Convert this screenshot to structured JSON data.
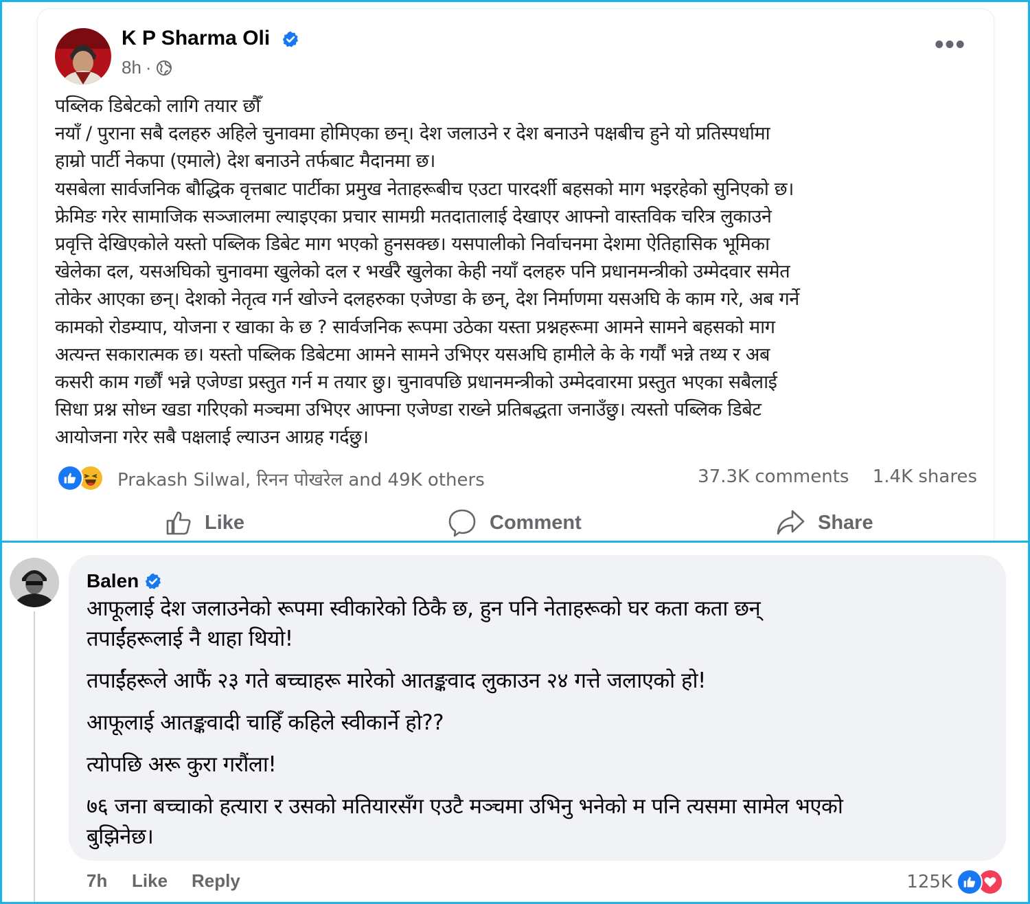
{
  "post": {
    "author": "K P Sharma Oli",
    "time": "8h",
    "separator": "·",
    "more_label": "•••",
    "body": [
      "पब्लिक डिबेटको लागि तयार छौँ",
      "नयाँ / पुराना सबै दलहरु अहिले चुनावमा होमिएका छन्। देश जलाउने र देश बनाउने पक्षबीच हुने यो प्रतिस्पर्धामा",
      "हाम्रो पार्टी नेकपा (एमाले) देश बनाउने तर्फबाट मैदानमा छ।",
      "यसबेला सार्वजनिक बौद्धिक वृत्तबाट पार्टीका प्रमुख नेताहरूबीच एउटा पारदर्शी बहसको माग भइरहेको सुनिएको छ।",
      "फ्रेमिङ गरेर सामाजिक सञ्जालमा ल्याइएका प्रचार सामग्री मतदातालाई देखाएर आफ्नो वास्तविक चरित्र लुकाउने",
      "प्रवृत्ति देखिएकोले यस्तो पब्लिक डिबेट माग भएको हुनसक्छ। यसपालीको निर्वाचनमा देशमा ऐतिहासिक भूमिका",
      "खेलेका दल, यसअघिको चुनावमा खुलेको दल र भर्खरै खुलेका केही नयाँ दलहरु पनि प्रधानमन्त्रीको उम्मेदवार समेत",
      "तोकेर आएका छन्। देशको नेतृत्व गर्न खोज्ने दलहरुका एजेण्डा के छन्, देश निर्माणमा यसअघि के काम गरे, अब गर्ने",
      "कामको रोडम्याप, योजना र  खाका के छ ? सार्वजनिक रूपमा उठेका यस्ता प्रश्नहरूमा आमने सामने बहसको माग",
      "अत्यन्त सकारात्मक छ। यस्तो पब्लिक डिबेटमा आमने सामने उभिएर यसअघि हामीले के के गर्यौं भन्ने तथ्य र अब",
      "कसरी काम गर्छौं भन्ने एजेण्डा प्रस्तुत गर्न म तयार छु। चुनावपछि प्रधानमन्त्रीको उम्मेदवारमा प्रस्तुत भएका सबैलाई",
      "सिधा प्रश्न सोध्न खडा गरिएको मञ्चमा उभिएर आफ्ना एजेण्डा राख्ने प्रतिबद्धता जनाउँछु।  त्यस्तो पब्लिक डिबेट",
      "आयोजना गरेर सबै पक्षलाई ल्याउन आग्रह गर्दछु।"
    ],
    "reactors": "Prakash Silwal, रिनन पोखरेल and 49K others",
    "comments_count": "37.3K comments",
    "shares_count": "1.4K shares",
    "actions": {
      "like": "Like",
      "comment": "Comment",
      "share": "Share"
    }
  },
  "comment": {
    "author": "Balen",
    "lines": [
      "आफूलाई देश जलाउनेको रूपमा स्वीकारेको ठिकै छ, हुन पनि नेताहरूको घर कता कता छन्",
      "तपाईंहरूलाई नै थाहा थियो!",
      "",
      "तपाईंहरूले आफैं २३ गते बच्चाहरू मारेको आतङ्कवाद लुकाउन २४ गत्ते जलाएको हो!",
      "",
      "आफूलाई आतङ्कवादी चाहिँ कहिले स्वीकार्ने हो??",
      "",
      "त्योपछि अरू कुरा गरौंला!",
      "",
      "७६ जना बच्चाको हत्यारा र उसको मतियारसँग एउटै मञ्चमा उभिनु भनेको म पनि त्यसमा सामेल भएको",
      "बुझिनेछ।"
    ],
    "time": "7h",
    "like": "Like",
    "reply": "Reply",
    "reaction_count": "125K"
  },
  "colors": {
    "frame_border": "#1ab2e8",
    "facebook_blue": "#1877f2",
    "secondary_text": "#65676b",
    "bubble_bg": "#f0f2f5",
    "love_red": "#f33e58",
    "haha_yellow": "#f7b928"
  },
  "icons": [
    "verified-badge-icon",
    "globe-icon",
    "more-icon",
    "like-reaction-icon",
    "haha-reaction-icon",
    "thumbs-up-icon",
    "comment-icon",
    "share-icon",
    "love-reaction-icon"
  ]
}
